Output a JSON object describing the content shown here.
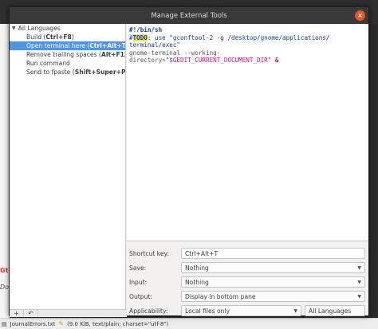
{
  "dialog": {
    "title": "Manage External Tools",
    "close_glyph": "×"
  },
  "tree": {
    "root_label": "All Languages",
    "items": [
      {
        "name": "Build (",
        "accel": "Ctrl+F8",
        "tail": ")",
        "selected": false
      },
      {
        "name": "Open terminal here (",
        "accel": "Ctrl+Alt+T",
        "tail": ")",
        "selected": true
      },
      {
        "name": "Remove trailing spaces (",
        "accel": "Alt+F12",
        "tail": ")",
        "selected": false
      },
      {
        "name": "Run command",
        "accel": "",
        "tail": "",
        "selected": false
      },
      {
        "name": "Send to fpaste (",
        "accel": "Shift+Super+P",
        "tail": ")",
        "selected": false
      }
    ]
  },
  "toolbar": {
    "add_glyph": "+",
    "revert_glyph": "↶"
  },
  "editor": {
    "line1": "#!/bin/sh",
    "line2_hash": "#",
    "line2_todo": "TODO",
    "line2_rest": ": use \"gconftool-2 -g /desktop/gnome/applications/",
    "line3": "terminal/exec\"",
    "line4": "gnome-terminal --working-",
    "line5_prefix": "directory=",
    "line5_string": "\"$GEDIT_CURRENT_DOCUMENT_DIR\"",
    "line5_amp": "&"
  },
  "form": {
    "shortcut_label": "Shortcut key:",
    "shortcut_value": "Ctrl+Alt+T",
    "save_label": "Save:",
    "save_value": "Nothing",
    "input_label": "Input:",
    "input_value": "Nothing",
    "output_label": "Output:",
    "output_value": "Display in bottom pane",
    "applicability_label": "Applicability:",
    "applicability_value": "Local files only",
    "languages_value": "All Languages"
  },
  "background": {
    "frag_err": "Gtk",
    "frag_text": "Don",
    "status_file": "JournalErrors.txt",
    "status_info": "(9.0 KiB, text/plain; charset=\"utf-8\")"
  }
}
